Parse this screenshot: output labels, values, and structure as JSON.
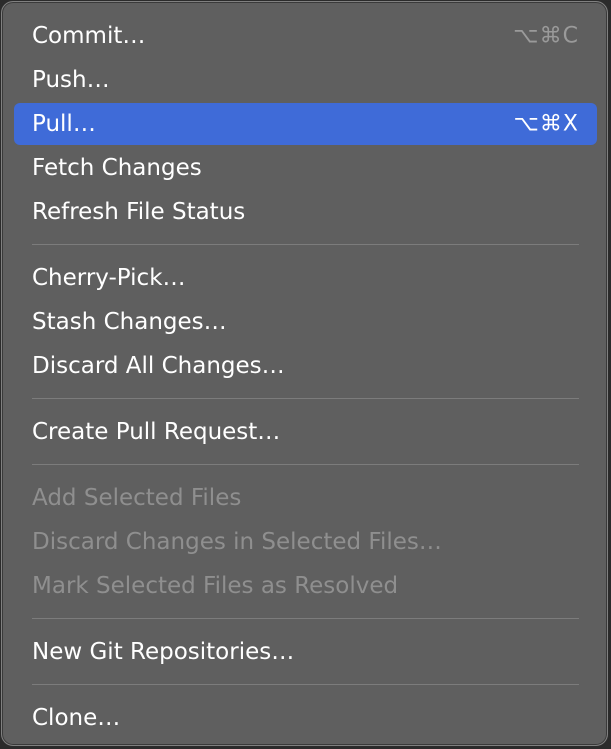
{
  "menu": {
    "items": [
      {
        "label": "Commit…",
        "shortcut": "⌥⌘C"
      },
      {
        "label": "Push…",
        "shortcut": ""
      },
      {
        "label": "Pull…",
        "shortcut": "⌥⌘X"
      },
      {
        "label": "Fetch Changes",
        "shortcut": ""
      },
      {
        "label": "Refresh File Status",
        "shortcut": ""
      },
      {
        "label": "Cherry-Pick…",
        "shortcut": ""
      },
      {
        "label": "Stash Changes…",
        "shortcut": ""
      },
      {
        "label": "Discard All Changes…",
        "shortcut": ""
      },
      {
        "label": "Create Pull Request…",
        "shortcut": ""
      },
      {
        "label": "Add Selected Files",
        "shortcut": ""
      },
      {
        "label": "Discard Changes in Selected Files…",
        "shortcut": ""
      },
      {
        "label": "Mark Selected Files as Resolved",
        "shortcut": ""
      },
      {
        "label": "New Git Repositories…",
        "shortcut": ""
      },
      {
        "label": "Clone…",
        "shortcut": ""
      }
    ]
  },
  "colors": {
    "menu_background": "#5f5f5f",
    "highlight": "#3f6bd8",
    "text": "#ffffff",
    "disabled_text": "#8f8f8f",
    "separator": "#7c7c7c"
  }
}
